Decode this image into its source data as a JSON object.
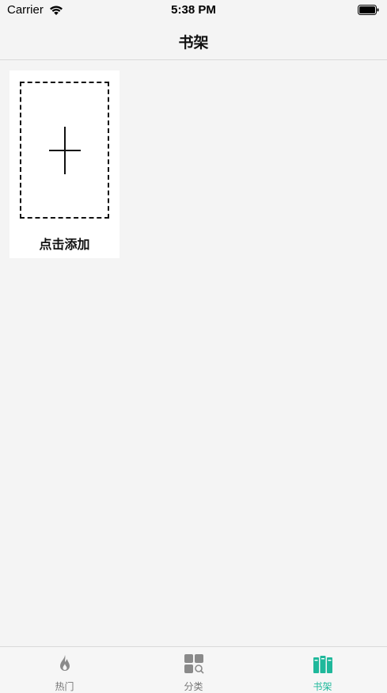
{
  "status_bar": {
    "carrier": "Carrier",
    "time": "5:38 PM"
  },
  "nav": {
    "title": "书架"
  },
  "shelf": {
    "add_label": "点击添加"
  },
  "tabs": [
    {
      "label": "热门",
      "icon": "flame-icon",
      "active": false
    },
    {
      "label": "分类",
      "icon": "category-grid-icon",
      "active": false
    },
    {
      "label": "书架",
      "icon": "bookshelf-icon",
      "active": true
    }
  ],
  "colors": {
    "accent": "#1fb89b",
    "inactive": "#8a8a8a",
    "background": "#f4f4f4"
  }
}
